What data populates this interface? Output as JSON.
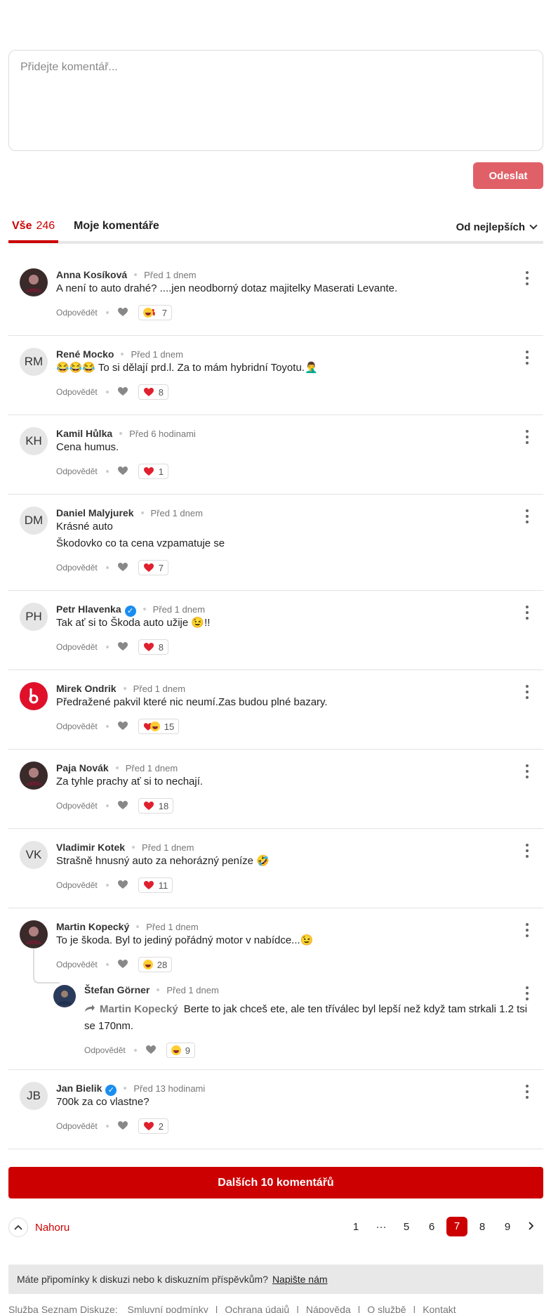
{
  "composer": {
    "placeholder": "Přidejte komentář...",
    "send_label": "Odeslat"
  },
  "tabs": {
    "all_label": "Vše",
    "all_count": "246",
    "mine_label": "Moje komentáře",
    "sort_label": "Od nejlepších"
  },
  "colors": {
    "accent": "#cc0000",
    "send_button": "#e06068",
    "heart": "#e0202e",
    "verified": "#1a8ef0"
  },
  "comments": [
    {
      "initials": "",
      "avatar_icon": "avatar-photo",
      "name": "Anna Kosíková",
      "time": "Před 1 dnem",
      "lines": [
        "A není to auto drahé? ....jen neodborný dotaz majitelky Maserati Levante."
      ],
      "reply_label": "Odpovědět",
      "reaction_icon": "laugh-heartbreak-icon",
      "reaction_count": "7"
    },
    {
      "initials": "RM",
      "name": "René Mocko",
      "time": "Před 1 dnem",
      "lines": [
        "😂😂😂 To si dělají prd.l. Za to mám hybridní Toyotu.🤦‍♂️"
      ],
      "reply_label": "Odpovědět",
      "reaction_icon": "heart-icon",
      "reaction_count": "8"
    },
    {
      "initials": "KH",
      "name": "Kamil Hůlka",
      "time": "Před 6 hodinami",
      "lines": [
        "Cena humus."
      ],
      "reply_label": "Odpovědět",
      "reaction_icon": "heart-icon",
      "reaction_count": "1"
    },
    {
      "initials": "DM",
      "name": "Daniel Malyjurek",
      "time": "Před 1 dnem",
      "lines": [
        "Krásné auto",
        "Škodovko co ta cena vzpamatuje se"
      ],
      "reply_label": "Odpovědět",
      "reaction_icon": "heart-icon",
      "reaction_count": "7"
    },
    {
      "initials": "PH",
      "name": "Petr Hlavenka",
      "verified": true,
      "time": "Před 1 dnem",
      "lines": [
        "Tak ať si to Škoda auto užije 😉!!"
      ],
      "reply_label": "Odpovědět",
      "reaction_icon": "heart-icon",
      "reaction_count": "8"
    },
    {
      "initials": "",
      "avatar_icon": "avatar-logo",
      "name": "Mirek Ondrik",
      "time": "Před 1 dnem",
      "lines": [
        "Předražené pakvil které nic neumí.Zas budou plné bazary."
      ],
      "reply_label": "Odpovědět",
      "reaction_icon": "heart-laugh-icon",
      "reaction_count": "15"
    },
    {
      "initials": "",
      "avatar_icon": "avatar-photo",
      "name": "Paja Novák",
      "time": "Před 1 dnem",
      "lines": [
        "Za tyhle prachy ať si to nechají."
      ],
      "reply_label": "Odpovědět",
      "reaction_icon": "heart-icon",
      "reaction_count": "18"
    },
    {
      "initials": "VK",
      "name": "Vladimir Kotek",
      "time": "Před 1 dnem",
      "lines": [
        "Strašně hnusný auto za nehorázný peníze 🤣"
      ],
      "reply_label": "Odpovědět",
      "reaction_icon": "heart-icon",
      "reaction_count": "11"
    },
    {
      "initials": "",
      "avatar_icon": "avatar-photo",
      "name": "Martin Kopecký",
      "time": "Před 1 dnem",
      "lines": [
        "To je škoda. Byl to jediný pořádný motor v nabídce...😉"
      ],
      "reply_label": "Odpovědět",
      "reaction_icon": "laugh-icon",
      "reaction_count": "28"
    },
    {
      "initials": "JB",
      "name": "Jan Bielik",
      "verified": true,
      "time": "Před 13 hodinami",
      "lines": [
        "700k za co vlastne?"
      ],
      "reply_label": "Odpovědět",
      "reaction_icon": "heart-icon",
      "reaction_count": "2"
    }
  ],
  "reply": {
    "name": "Štefan Görner",
    "time": "Před 1 dnem",
    "mention": "Martin Kopecký",
    "line1": "Berte to jak chceš ete, ale ten tříválec byl lepší než když tam strkali 1.2 tsi",
    "line2": "se 170nm.",
    "reply_label": "Odpovědět",
    "reaction_icon": "laugh-icon",
    "reaction_count": "9"
  },
  "more_label": "Dalších 10 komentářů",
  "nahoru_label": "Nahoru",
  "pagination": {
    "pages": [
      "1",
      "···",
      "5",
      "6",
      "7",
      "8",
      "9"
    ],
    "current": "7"
  },
  "feedback": {
    "text": "Máte připomínky k diskuzi nebo k diskuzním příspěvkům?",
    "link": "Napište nám"
  },
  "footer": {
    "service": "Služba Seznam Diskuze:",
    "links": [
      "Smluvní podmínky",
      "Ochrana údajů",
      "Nápověda",
      "O službě",
      "Kontakt"
    ]
  }
}
